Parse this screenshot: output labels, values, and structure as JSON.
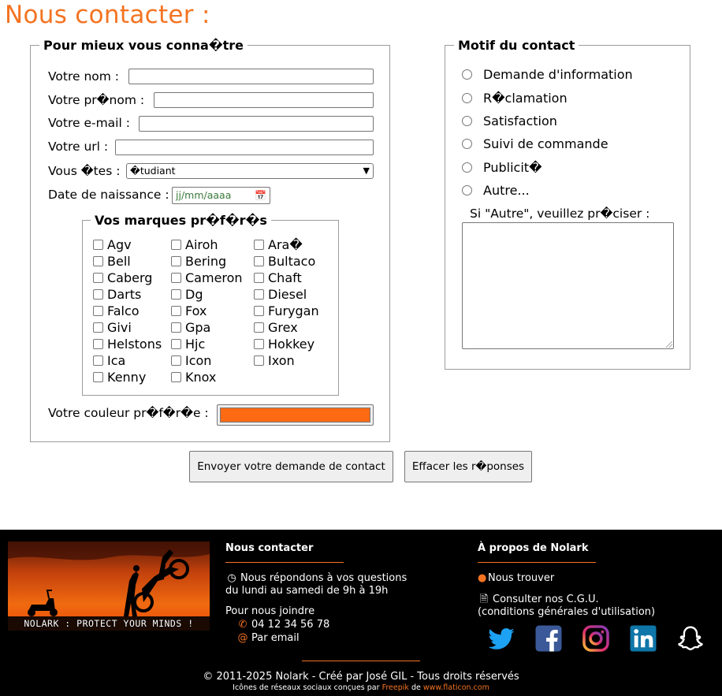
{
  "page": {
    "title": "Nous contacter :"
  },
  "identity": {
    "legend": "Pour mieux vous conna�tre",
    "nom_label": "Votre nom :",
    "nom_value": "",
    "prenom_label": "Votre pr�nom :",
    "prenom_value": "",
    "email_label": "Votre e-mail :",
    "email_value": "",
    "url_label": "Votre url :",
    "url_value": "",
    "status_label": "Vous �tes :",
    "status_value": "�tudiant",
    "birth_label": "Date de naissance :",
    "birth_placeholder": "jj/mm/aaaa",
    "color_label": "Votre couleur pr�f�r�e :",
    "color_value": "#ff6a13"
  },
  "brands": {
    "legend": "Vos marques pr�f�r�s",
    "items": [
      "Agv",
      "Airoh",
      "Ara�",
      "Bell",
      "Bering",
      "Bultaco",
      "Caberg",
      "Cameron",
      "Chaft",
      "Darts",
      "Dg",
      "Diesel",
      "Falco",
      "Fox",
      "Furygan",
      "Givi",
      "Gpa",
      "Grex",
      "Helstons",
      "Hjc",
      "Hokkey",
      "Ica",
      "Icon",
      "Ixon",
      "Kenny",
      "Knox"
    ]
  },
  "motif": {
    "legend": "Motif du contact",
    "options": [
      "Demande d'information",
      "R�clamation",
      "Satisfaction",
      "Suivi de commande",
      "Publicit�",
      "Autre..."
    ],
    "other_label": "Si \"Autre\", veuillez pr�ciser :",
    "other_value": ""
  },
  "actions": {
    "send_label": "Envoyer votre demande de contact",
    "reset_label": "Effacer les r�ponses"
  },
  "footer": {
    "tagline": "NOLARK : PROTECT YOUR MINDS !",
    "contact_heading": "Nous contacter",
    "hours_line1": "Nous répondons à vos questions",
    "hours_line2": "du lundi au samedi de 9h à 19h",
    "join_label": "Pour nous joindre",
    "phone": "04 12 34 56 78",
    "email_link": "Par email",
    "about_heading": "À propos de Nolark",
    "find_us": "Nous trouver",
    "cgu_line1": "Consulter nos C.G.U.",
    "cgu_line2": "(conditions générales d'utilisation)",
    "copyright": "© 2011-2025 Nolark - Créé par José GIL - Tous droits réservés",
    "credits_prefix": "Icônes de réseaux sociaux conçues par",
    "credits_freepik": "Freepik",
    "credits_mid": "de",
    "credits_site": "www.flaticon.com",
    "social_icons": [
      "twitter-icon",
      "facebook-icon",
      "instagram-icon",
      "linkedin-icon",
      "snapchat-icon"
    ],
    "colors": {
      "accent": "#f47321",
      "background": "#000000"
    }
  }
}
